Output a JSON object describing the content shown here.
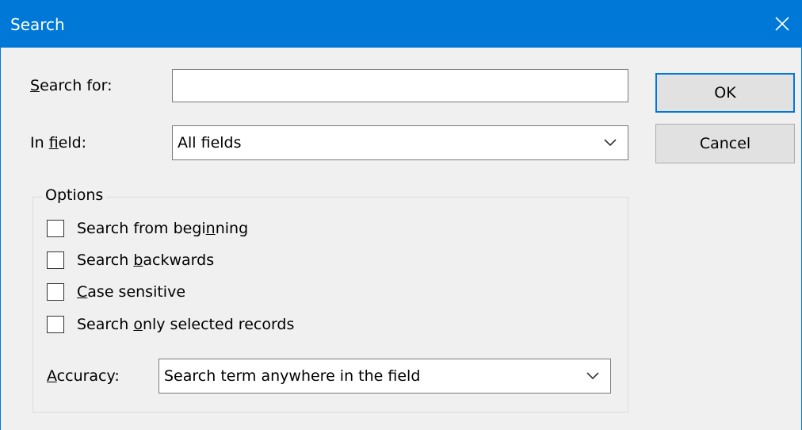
{
  "dialog": {
    "title": "Search",
    "close_icon": "close-icon"
  },
  "search_for": {
    "label_prefix": "",
    "label_mnemonic": "S",
    "label_rest": "earch for:",
    "value": ""
  },
  "in_field": {
    "label_prefix": "In ",
    "label_mnemonic": "f",
    "label_rest": "ield:",
    "selected": "All fields"
  },
  "buttons": {
    "ok": "OK",
    "cancel": "Cancel"
  },
  "options": {
    "title": "Options",
    "checkboxes": [
      {
        "prefix": "Search from begi",
        "mnemonic": "n",
        "rest": "ning",
        "checked": false
      },
      {
        "prefix": "Search ",
        "mnemonic": "b",
        "rest": "ackwards",
        "checked": false
      },
      {
        "prefix": "",
        "mnemonic": "C",
        "rest": "ase sensitive",
        "checked": false
      },
      {
        "prefix": "Search ",
        "mnemonic": "o",
        "rest": "nly selected records",
        "checked": false
      }
    ],
    "accuracy": {
      "label_prefix": "",
      "label_mnemonic": "A",
      "label_rest": "ccuracy:",
      "selected": "Search term anywhere in the field"
    }
  },
  "colors": {
    "titlebar": "#0078d7",
    "dialog_bg": "#f0f0f0",
    "default_button_border": "#0078d7"
  }
}
